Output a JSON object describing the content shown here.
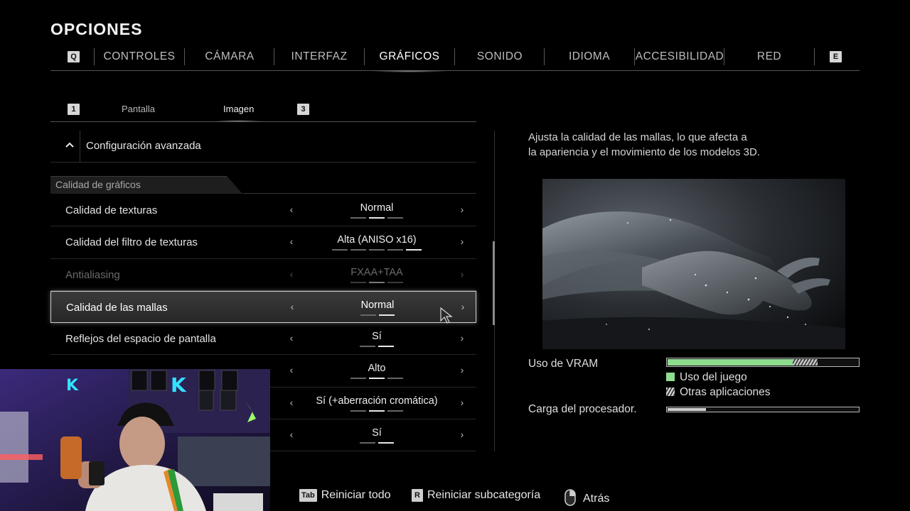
{
  "title": "OPCIONES",
  "top_tabs": {
    "left_key": "Q",
    "right_key": "E",
    "items": [
      "CONTROLES",
      "CÁMARA",
      "INTERFAZ",
      "GRÁFICOS",
      "SONIDO",
      "IDIOMA",
      "ACCESIBILIDAD",
      "RED"
    ],
    "active": "GRÁFICOS"
  },
  "sub_tabs": {
    "left_key": "1",
    "right_key": "3",
    "items": [
      "Pantalla",
      "Imagen"
    ],
    "active": "Imagen"
  },
  "advanced": {
    "label": "Configuración avanzada",
    "icon": "chevron-up-icon"
  },
  "section": {
    "title": "Calidad de gráficos"
  },
  "settings": [
    {
      "label": "Calidad de texturas",
      "value": "Normal",
      "level": 2,
      "steps": 3,
      "state": "normal"
    },
    {
      "label": "Calidad del filtro de texturas",
      "value": "Alta (ANISO x16)",
      "level": 5,
      "steps": 5,
      "state": "normal"
    },
    {
      "label": "Antialiasing",
      "value": "FXAA+TAA",
      "level": 2,
      "steps": 3,
      "state": "disabled"
    },
    {
      "label": "Calidad de las mallas",
      "value": "Normal",
      "level": 2,
      "steps": 2,
      "state": "selected"
    },
    {
      "label": "Reflejos del espacio de pantalla",
      "value": "Sí",
      "level": 2,
      "steps": 2,
      "state": "normal"
    },
    {
      "label": "",
      "value": "Alto",
      "level": 2,
      "steps": 3,
      "state": "normal"
    },
    {
      "label": "",
      "value": "Sí (+aberración cromática)",
      "level": 2,
      "steps": 3,
      "state": "normal"
    },
    {
      "label": "",
      "value": "Sí",
      "level": 2,
      "steps": 2,
      "state": "normal"
    }
  ],
  "description": {
    "line1": "Ajusta la calidad de las mallas, lo que afecta a",
    "line2": "la apariencia y el movimiento de los modelos 3D."
  },
  "vram": {
    "label": "Uso de VRAM",
    "game_fraction": 0.65,
    "other_fraction": 0.13,
    "game_color": "#8fdc8f",
    "legend_game": "Uso del juego",
    "legend_other": "Otras aplicaciones"
  },
  "cpu": {
    "label": "Carga del procesador.",
    "fraction": 0.2
  },
  "footer": {
    "reset_all_key": "Tab",
    "reset_all": "Reiniciar todo",
    "reset_sub_key": "R",
    "reset_sub": "Reiniciar subcategoría",
    "back_icon": "mouse-icon",
    "back": "Atrás"
  }
}
